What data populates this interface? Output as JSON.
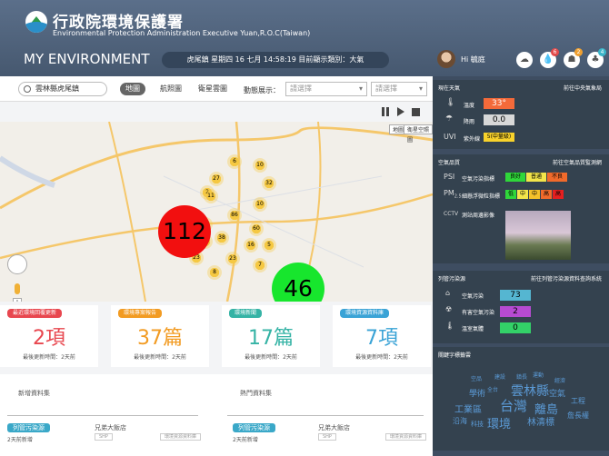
{
  "header": {
    "org_cn": "行政院環境保護署",
    "org_en": "Environmental Protection Administration Executive Yuan,R.O.C(Taiwan)",
    "page_title": "MY ENVIRONMENT",
    "status": "虎尾鎮   星期四 16 七月 14:58:19   目前顯示類別：大氣",
    "greeting": "Hi 毓庭",
    "icons": [
      "cloud-icon",
      "water-drop-icon",
      "person-icon",
      "tree-icon"
    ],
    "badges": [
      "6",
      "2",
      "4",
      "4"
    ],
    "badge_colors": [
      "#e24b4b",
      "#e24b4b",
      "#f0a030",
      "#3ab5c9"
    ]
  },
  "toolbar": {
    "search_value": "雲林縣虎尾鎮",
    "tabs": [
      "地圖",
      "航照圖",
      "衛星雲圖"
    ],
    "dynamic_label": "動態展示：",
    "select1_placeholder": "請選擇",
    "select2_placeholder": "請選擇"
  },
  "map": {
    "btn_map": "地圖",
    "btn_satellite": "衛星空照圖",
    "big_red": "112",
    "big_green": "46",
    "clusters": [
      "6",
      "10",
      "27",
      "2",
      "32",
      "11",
      "10",
      "86",
      "12",
      "6",
      "60",
      "37",
      "38",
      "16",
      "5",
      "4",
      "23",
      "23",
      "7",
      "8"
    ]
  },
  "cards": [
    {
      "label": "最近環境回覆更新",
      "value": "2項",
      "update": "最後更新時間：2天前",
      "color": "#e8474f"
    },
    {
      "label": "環境專案報告",
      "value": "37篇",
      "update": "最後更新時間：2天前",
      "color": "#f29b22"
    },
    {
      "label": "環境新聞",
      "value": "17篇",
      "update": "最後更新時間：2天前",
      "color": "#35b3a5"
    },
    {
      "label": "環境資源資料庫",
      "value": "7項",
      "update": "最後更新時間：2天前",
      "color": "#3aa3d6"
    }
  ],
  "bottom": {
    "left_title": "新增資料集",
    "right_title": "熱門資料集",
    "left_tag": "列管污染源",
    "left_sub": "2天前新增",
    "left_item": "兄弟大飯店",
    "left_type": "SHP",
    "left_tag2": "環境資源資料庫",
    "right_tag": "列管污染源",
    "right_sub": "2天前新增",
    "right_item": "兄弟大飯店",
    "right_type": "SHP",
    "right_tag2": "環境資源資料庫"
  },
  "weather": {
    "title": "現在天氣",
    "link": "前往中央氣象局",
    "temp_label": "溫度",
    "temp": "33°",
    "rain_label": "降雨",
    "rain": "0.0",
    "uvi_label": "紫外線",
    "uvi_prefix": "UVI",
    "uvi": "5(中量級)"
  },
  "air": {
    "title": "空氣品質",
    "link": "前往空氣品質監測網",
    "psi_prefix": "PSI",
    "psi_label": "空氣污染指標",
    "psi_levels": [
      "良好",
      "普通",
      "不良"
    ],
    "pm_prefix": "PM",
    "pm_sub": "2.5",
    "pm_label": "細懸浮微粒指標",
    "pm_levels": [
      "低",
      "中",
      "中",
      "高",
      "高"
    ],
    "cctv_prefix": "CCTV",
    "cctv_label": "測站周邊影像"
  },
  "pollution": {
    "title": "列管污染源",
    "link": "前往列管污染源資料查詢系統",
    "items": [
      {
        "label": "空氣污染",
        "value": "73",
        "color": "#55b6d1"
      },
      {
        "label": "有害空氣污染",
        "value": "2",
        "color": "#b64bd1"
      },
      {
        "label": "溫室氣體",
        "value": "0",
        "color": "#33d168"
      }
    ]
  },
  "keywords": {
    "title": "關鍵字標籤雲",
    "words": [
      "雲林縣",
      "台灣",
      "離島",
      "環境",
      "工業區",
      "林清標",
      "空氣",
      "學術",
      "沿海",
      "科技",
      "工程",
      "詹長權",
      "空品",
      "鎮長",
      "建設",
      "全台",
      "運動",
      "經濟"
    ]
  }
}
